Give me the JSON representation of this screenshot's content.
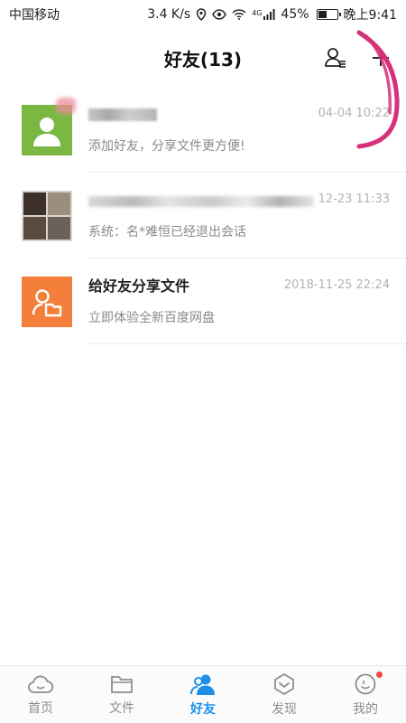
{
  "status_bar": {
    "carrier": "中国移动",
    "speed": "3.4 K/s",
    "network_tag": "4G",
    "battery": "45%",
    "battery_level": 0.45,
    "time": "晚上9:41"
  },
  "header": {
    "title": "好友(13)",
    "contacts_icon": "contacts-list-icon",
    "add_icon": "plus-icon"
  },
  "list": [
    {
      "avatar": "default-user-avatar",
      "title": "",
      "time": "04-04 10:22",
      "subtitle": "添加好友，分享文件更方便!"
    },
    {
      "avatar": "group-photo-avatar",
      "title": "",
      "time": "12-23 11:33",
      "subtitle": "系统：名*难恒已经退出会话"
    },
    {
      "avatar": "share-folder-avatar",
      "title": "给好友分享文件",
      "time": "2018-11-25 22:24",
      "subtitle": "立即体验全新百度网盘"
    }
  ],
  "bottom_nav": [
    {
      "label": "首页",
      "icon": "cloud-icon"
    },
    {
      "label": "文件",
      "icon": "folder-icon"
    },
    {
      "label": "好友",
      "icon": "friends-icon",
      "active": true
    },
    {
      "label": "发现",
      "icon": "discover-icon"
    },
    {
      "label": "我的",
      "icon": "profile-icon",
      "badge": true
    }
  ],
  "colors": {
    "accent": "#1e90ea",
    "green_avatar": "#7bb843",
    "orange_avatar": "#f47f3a",
    "badge": "#f04848",
    "scribble": "#d6307a"
  }
}
